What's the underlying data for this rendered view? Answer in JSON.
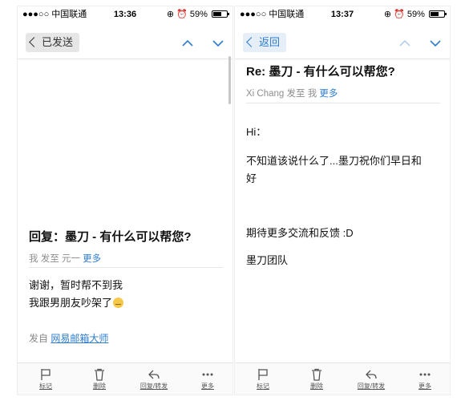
{
  "left": {
    "status": {
      "carrier": "●●●○○ 中国联通",
      "time": "13:36",
      "battery": "59%"
    },
    "nav": {
      "back_label": "已发送"
    },
    "subject": "回复：墨刀 - 有什么可以帮您?",
    "meta": {
      "from": "我",
      "sent_to": "发至",
      "to": "元一",
      "more": "更多"
    },
    "body_lines": [
      "谢谢，暂时帮不到我",
      "我跟男朋友吵架了"
    ],
    "sender": {
      "prefix": "发自",
      "app": "网易邮箱大师"
    },
    "toolbar": {
      "flag": "标记",
      "delete": "删除",
      "reply": "回复/转发",
      "more": "更多"
    }
  },
  "right": {
    "status": {
      "carrier": "●●●○○ 中国联通",
      "time": "13:37",
      "battery": "59%"
    },
    "nav": {
      "back_label": "返回"
    },
    "subject": "Re: 墨刀 - 有什么可以帮您?",
    "meta": {
      "from": "Xi Chang",
      "sent_to": "发至",
      "to": "我",
      "more": "更多"
    },
    "body_lines": [
      "Hi：",
      "不知道该说什么了...墨刀祝你们早日和",
      "好",
      "期待更多交流和反馈 :D",
      "墨刀团队"
    ],
    "toolbar": {
      "flag": "标记",
      "delete": "删除",
      "reply": "回复/转发",
      "more": "更多"
    }
  },
  "colors": {
    "accent": "#2e7ccd",
    "muted": "#8e8e8e"
  }
}
